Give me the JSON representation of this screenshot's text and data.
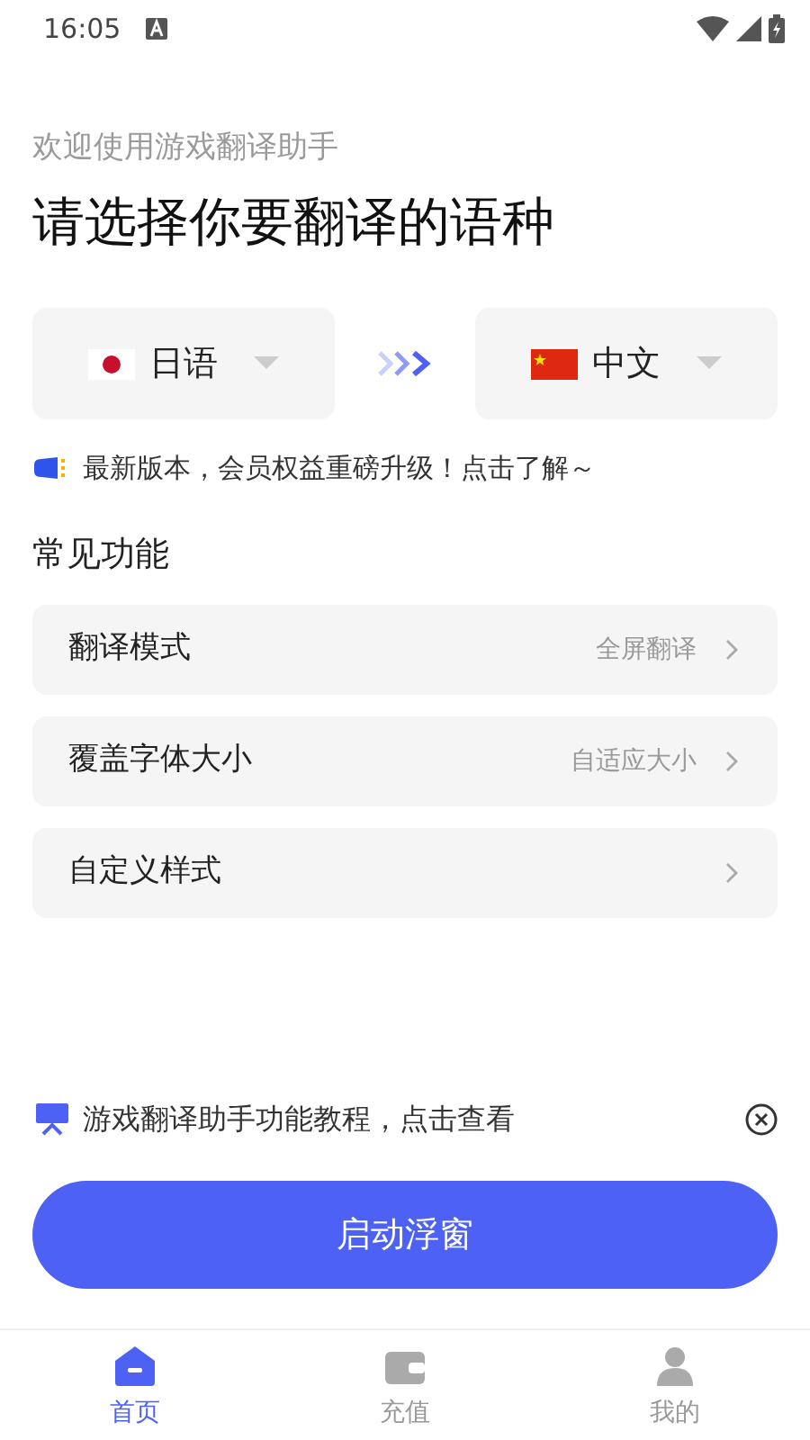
{
  "status_bar": {
    "time": "16:05"
  },
  "subtitle": "欢迎使用游戏翻译助手",
  "title": "请选择你要翻译的语种",
  "languages": {
    "source": {
      "label": "日语",
      "kind": "japan"
    },
    "target": {
      "label": "中文",
      "kind": "china"
    }
  },
  "notice": "最新版本，会员权益重磅升级！点击了解～",
  "section_title": "常见功能",
  "settings": [
    {
      "label": "翻译模式",
      "value": "全屏翻译"
    },
    {
      "label": "覆盖字体大小",
      "value": "自适应大小"
    },
    {
      "label": "自定义样式"
    }
  ],
  "tutorial": "游戏翻译助手功能教程，点击查看",
  "start_button": "启动浮窗",
  "tabs": [
    {
      "label": "首页",
      "selected": true,
      "kind": "home"
    },
    {
      "label": "充值",
      "selected": false,
      "kind": "recharge"
    },
    {
      "label": "我的",
      "selected": false,
      "kind": "profile"
    }
  ]
}
